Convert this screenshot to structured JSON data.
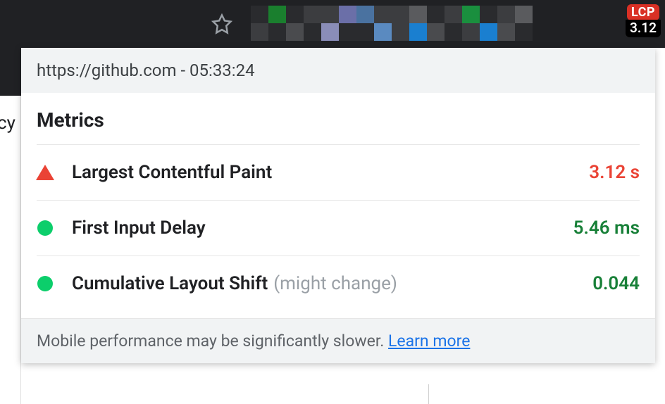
{
  "badge": {
    "label": "LCP",
    "value": "3.12"
  },
  "popup": {
    "header": "https://github.com - 05:33:24",
    "title": "Metrics",
    "metrics": [
      {
        "status": "poor",
        "label": "Largest Contentful Paint",
        "note": "",
        "value": "3.12 s",
        "color": "red"
      },
      {
        "status": "good",
        "label": "First Input Delay",
        "note": "",
        "value": "5.46 ms",
        "color": "green"
      },
      {
        "status": "good",
        "label": "Cumulative Layout Shift",
        "note": "(might change)",
        "value": "0.044",
        "color": "green"
      }
    ],
    "footer_text": "Mobile performance may be significantly slower. ",
    "footer_link": "Learn more"
  },
  "left_text": "cy"
}
